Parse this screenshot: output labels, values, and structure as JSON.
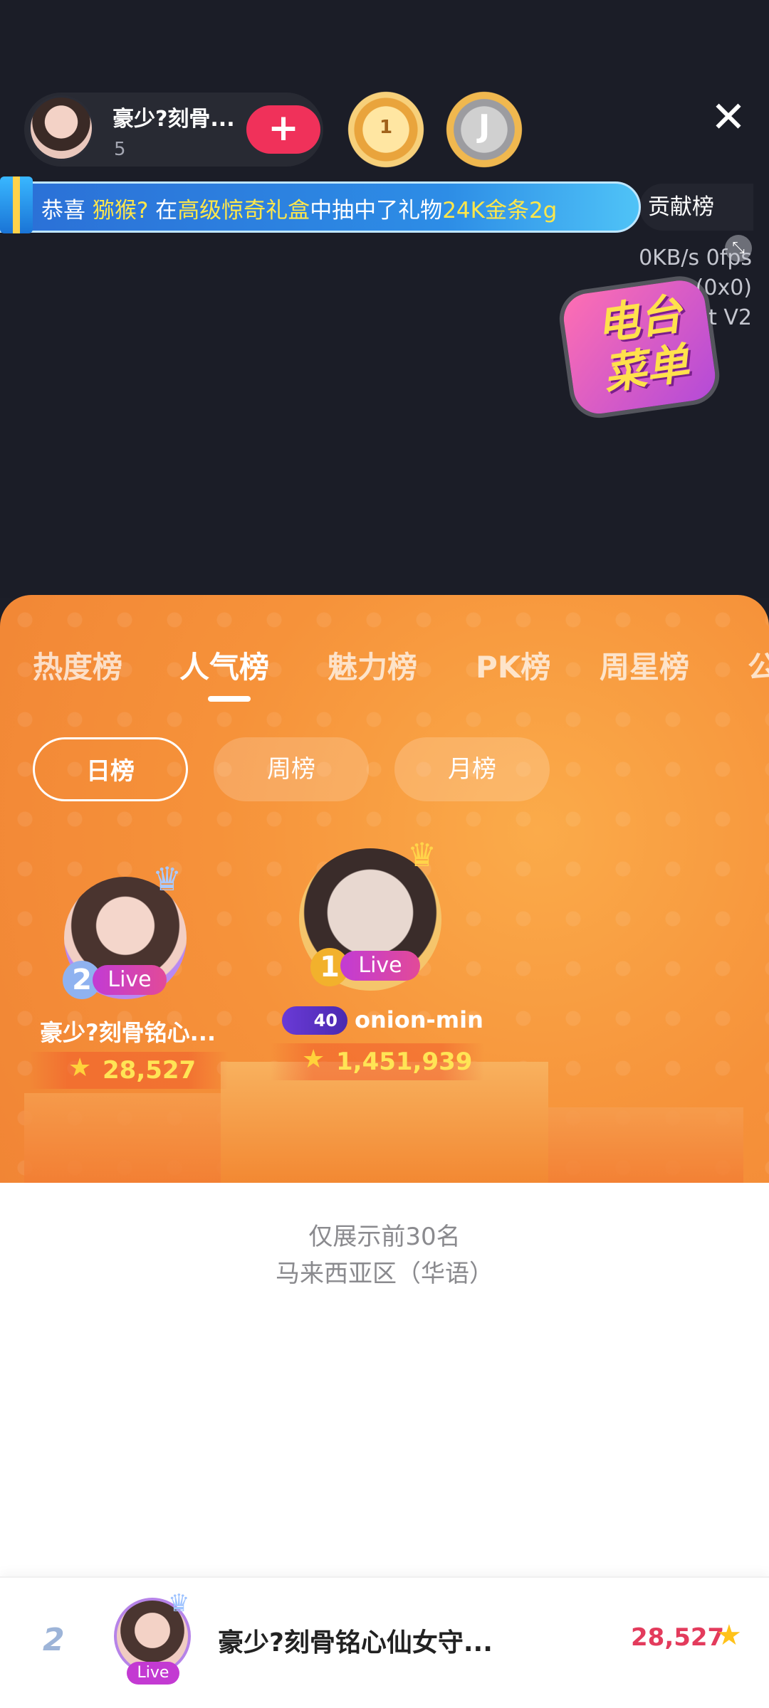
{
  "header": {
    "host_name": "豪少?刻骨...",
    "host_count": "5",
    "follow_label": "+",
    "medal_1_label": "1",
    "medal_2_label": "J",
    "close_label": "✕"
  },
  "banner": {
    "prefix": "恭喜 ",
    "user": "猕猴?",
    "mid1": " 在",
    "box": "高级惊奇礼盒",
    "mid2": "中抽中了礼物",
    "gift": "24K金条2g",
    "contrib_label": "贡献榜"
  },
  "stats": {
    "line1": "0KB/s 0fps",
    "line2": "(0x0)",
    "line3": "Tencent V2"
  },
  "menu_badge": {
    "line1": "电台",
    "line2": "菜单"
  },
  "tabs": [
    "热度榜",
    "人气榜",
    "魅力榜",
    "PK榜",
    "周星榜",
    "公"
  ],
  "active_tab": "人气榜",
  "periods": [
    "日榜",
    "周榜",
    "月榜"
  ],
  "active_period": "日榜",
  "podium": {
    "first": {
      "rank": "1",
      "name": "onion-min",
      "level": "40",
      "score": "1,451,939",
      "live": "Live"
    },
    "second": {
      "rank": "2",
      "name": "豪少?刻骨铭心...",
      "score": "28,527",
      "live": "Live"
    }
  },
  "info": {
    "line1": "仅展示前30名",
    "line2": "马来西亚区（华语）"
  },
  "my_row": {
    "rank": "2",
    "live": "Live",
    "name": "豪少?刻骨铭心仙女守...",
    "score": "28,527"
  },
  "colors": {
    "accent_pink": "#f0315a",
    "panel_orange": "#f6923a",
    "score_yellow": "#ffe455",
    "score_red": "#e33b5c"
  }
}
